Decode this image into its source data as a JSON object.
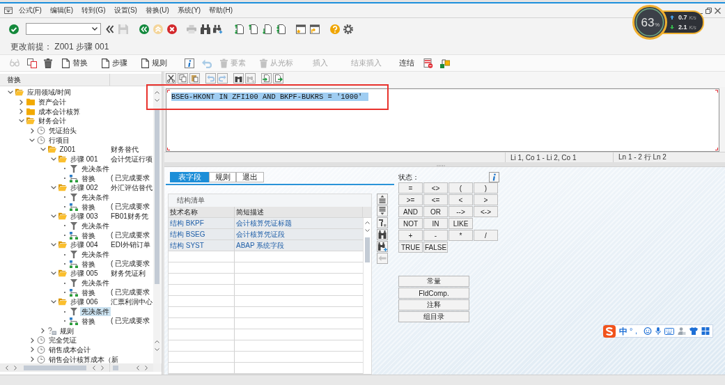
{
  "menu_bar": {
    "items": [
      "公式(F)",
      "编辑(E)",
      "转到(G)",
      "设置(S)",
      "替换(U)",
      "系统(Y)",
      "帮助(H)"
    ]
  },
  "title": "更改前提： Z001 步骤 001",
  "app_toolbar": {
    "object_buttons": [
      {
        "label": "替换",
        "disabled": false
      },
      {
        "label": "步骤",
        "disabled": false
      },
      {
        "label": "规则",
        "disabled": false
      }
    ],
    "edit_buttons": [
      {
        "label": "要素",
        "kind": "trash",
        "disabled": true
      },
      {
        "label": "从光标",
        "kind": "trash",
        "disabled": true
      },
      {
        "label": "插入",
        "kind": "text",
        "disabled": true
      },
      {
        "label": "结束插入",
        "kind": "text",
        "disabled": true
      },
      {
        "label": "连结",
        "kind": "text",
        "disabled": false
      }
    ]
  },
  "tree": {
    "header": "替换",
    "nodes": [
      {
        "label": "应用领域/时间",
        "kind": "folder",
        "expanded": true,
        "selected": false,
        "children": [
          {
            "label": "资产会计",
            "kind": "folder",
            "expanded": false,
            "selected": false
          },
          {
            "label": "成本会计核算",
            "kind": "folder",
            "expanded": false,
            "selected": false
          },
          {
            "label": "财务会计",
            "kind": "folder",
            "expanded": true,
            "selected": false,
            "children": [
              {
                "label": "凭证抬头",
                "kind": "clock",
                "expanded": false,
                "selected": false
              },
              {
                "label": "行项目",
                "kind": "clock",
                "expanded": true,
                "selected": false,
                "children": [
                  {
                    "label": "Z001",
                    "description": "财务替代",
                    "kind": "folder",
                    "expanded": true,
                    "selected": false,
                    "children": [
                      {
                        "label": "步骤 001",
                        "description": "会计凭证行项",
                        "kind": "folder",
                        "expanded": true,
                        "selected": false,
                        "children": [
                          {
                            "label": "先决条件",
                            "kind": "funnel",
                            "selected": false
                          },
                          {
                            "label": "替换",
                            "description": "( 已完成要求",
                            "kind": "substitution",
                            "selected": false
                          }
                        ]
                      },
                      {
                        "label": "步骤 002",
                        "description": "外汇评估替代",
                        "kind": "folder",
                        "expanded": true,
                        "selected": false,
                        "children": [
                          {
                            "label": "先决条件",
                            "kind": "funnel",
                            "selected": false
                          },
                          {
                            "label": "替换",
                            "description": "( 已完成要求",
                            "kind": "substitution",
                            "selected": false
                          }
                        ]
                      },
                      {
                        "label": "步骤 003",
                        "description": "FB01财务凭",
                        "kind": "folder",
                        "expanded": true,
                        "selected": false,
                        "children": [
                          {
                            "label": "先决条件",
                            "kind": "funnel",
                            "selected": false
                          },
                          {
                            "label": "替换",
                            "description": "( 已完成要求",
                            "kind": "substitution",
                            "selected": false
                          }
                        ]
                      },
                      {
                        "label": "步骤 004",
                        "description": "EDI外销订单",
                        "kind": "folder",
                        "expanded": true,
                        "selected": false,
                        "children": [
                          {
                            "label": "先决条件",
                            "kind": "funnel",
                            "selected": false
                          },
                          {
                            "label": "替换",
                            "description": "( 已完成要求",
                            "kind": "substitution",
                            "selected": false
                          }
                        ]
                      },
                      {
                        "label": "步骤 005",
                        "description": "财务凭证利",
                        "kind": "folder",
                        "expanded": true,
                        "selected": false,
                        "children": [
                          {
                            "label": "先决条件",
                            "kind": "funnel",
                            "selected": false
                          },
                          {
                            "label": "替换",
                            "description": "( 已完成要求",
                            "kind": "substitution",
                            "selected": false
                          }
                        ]
                      },
                      {
                        "label": "步骤 006",
                        "description": "汇票利润中心",
                        "kind": "folder",
                        "expanded": true,
                        "selected": false,
                        "children": [
                          {
                            "label": "先决条件",
                            "kind": "funnel",
                            "selected": true
                          },
                          {
                            "label": "替换",
                            "description": "( 已完成要求",
                            "kind": "substitution",
                            "selected": false
                          }
                        ]
                      }
                    ]
                  },
                  {
                    "label": "规则",
                    "kind": "rule",
                    "expanded": false,
                    "selected": false
                  }
                ]
              },
              {
                "label": "完全凭证",
                "kind": "clock",
                "expanded": false,
                "selected": false
              },
              {
                "label": "销售成本会计",
                "kind": "clock",
                "expanded": false,
                "selected": false
              },
              {
                "label": "销售会计核算成本（新",
                "kind": "clock",
                "expanded": false,
                "selected": false
              }
            ]
          }
        ]
      }
    ]
  },
  "editor": {
    "lines": [
      "BSEG-HKONT IN ZFI100 AND BKPF-BUKRS = '1000'"
    ],
    "selected": true,
    "cursor_position": "Li 1, Co 1 - Li 2, Co 1",
    "line_info": "Ln 1 - 2 行 Ln 2"
  },
  "tabs": [
    {
      "label": "表字段",
      "selected": true
    },
    {
      "label": "规则",
      "selected": false
    },
    {
      "label": "退出",
      "selected": false
    }
  ],
  "structure_list": {
    "title": "结构清单",
    "columns": [
      "技术名称",
      "简短描述"
    ],
    "rows": [
      [
        "结构 BKPF",
        "会计核算凭证标题"
      ],
      [
        "结构 BSEG",
        "会计核算凭证段"
      ],
      [
        "结构 SYST",
        "ABAP 系统字段"
      ]
    ]
  },
  "status_label": "状态：",
  "operators": [
    [
      "=",
      "<>",
      "(",
      ")"
    ],
    [
      ">=",
      "<=",
      "<",
      ">"
    ],
    [
      "AND",
      "OR",
      "-->",
      "<->"
    ],
    [
      "NOT",
      "IN",
      "LIKE"
    ],
    [
      "+",
      "-",
      "*",
      "/"
    ],
    [
      "TRUE",
      "FALSE"
    ]
  ],
  "extra_buttons": [
    "常量",
    "FldComp.",
    "注释",
    "组目录"
  ],
  "network_monitor": {
    "usage": "63",
    "usage_unit": "%",
    "rates": [
      {
        "kind": "upload",
        "value": "0.7",
        "unit": "K/s"
      },
      {
        "kind": "download",
        "value": "2.1",
        "unit": "K/s"
      }
    ]
  },
  "ime_toolbar": {
    "mode": "中",
    "punctuation": "°，"
  }
}
